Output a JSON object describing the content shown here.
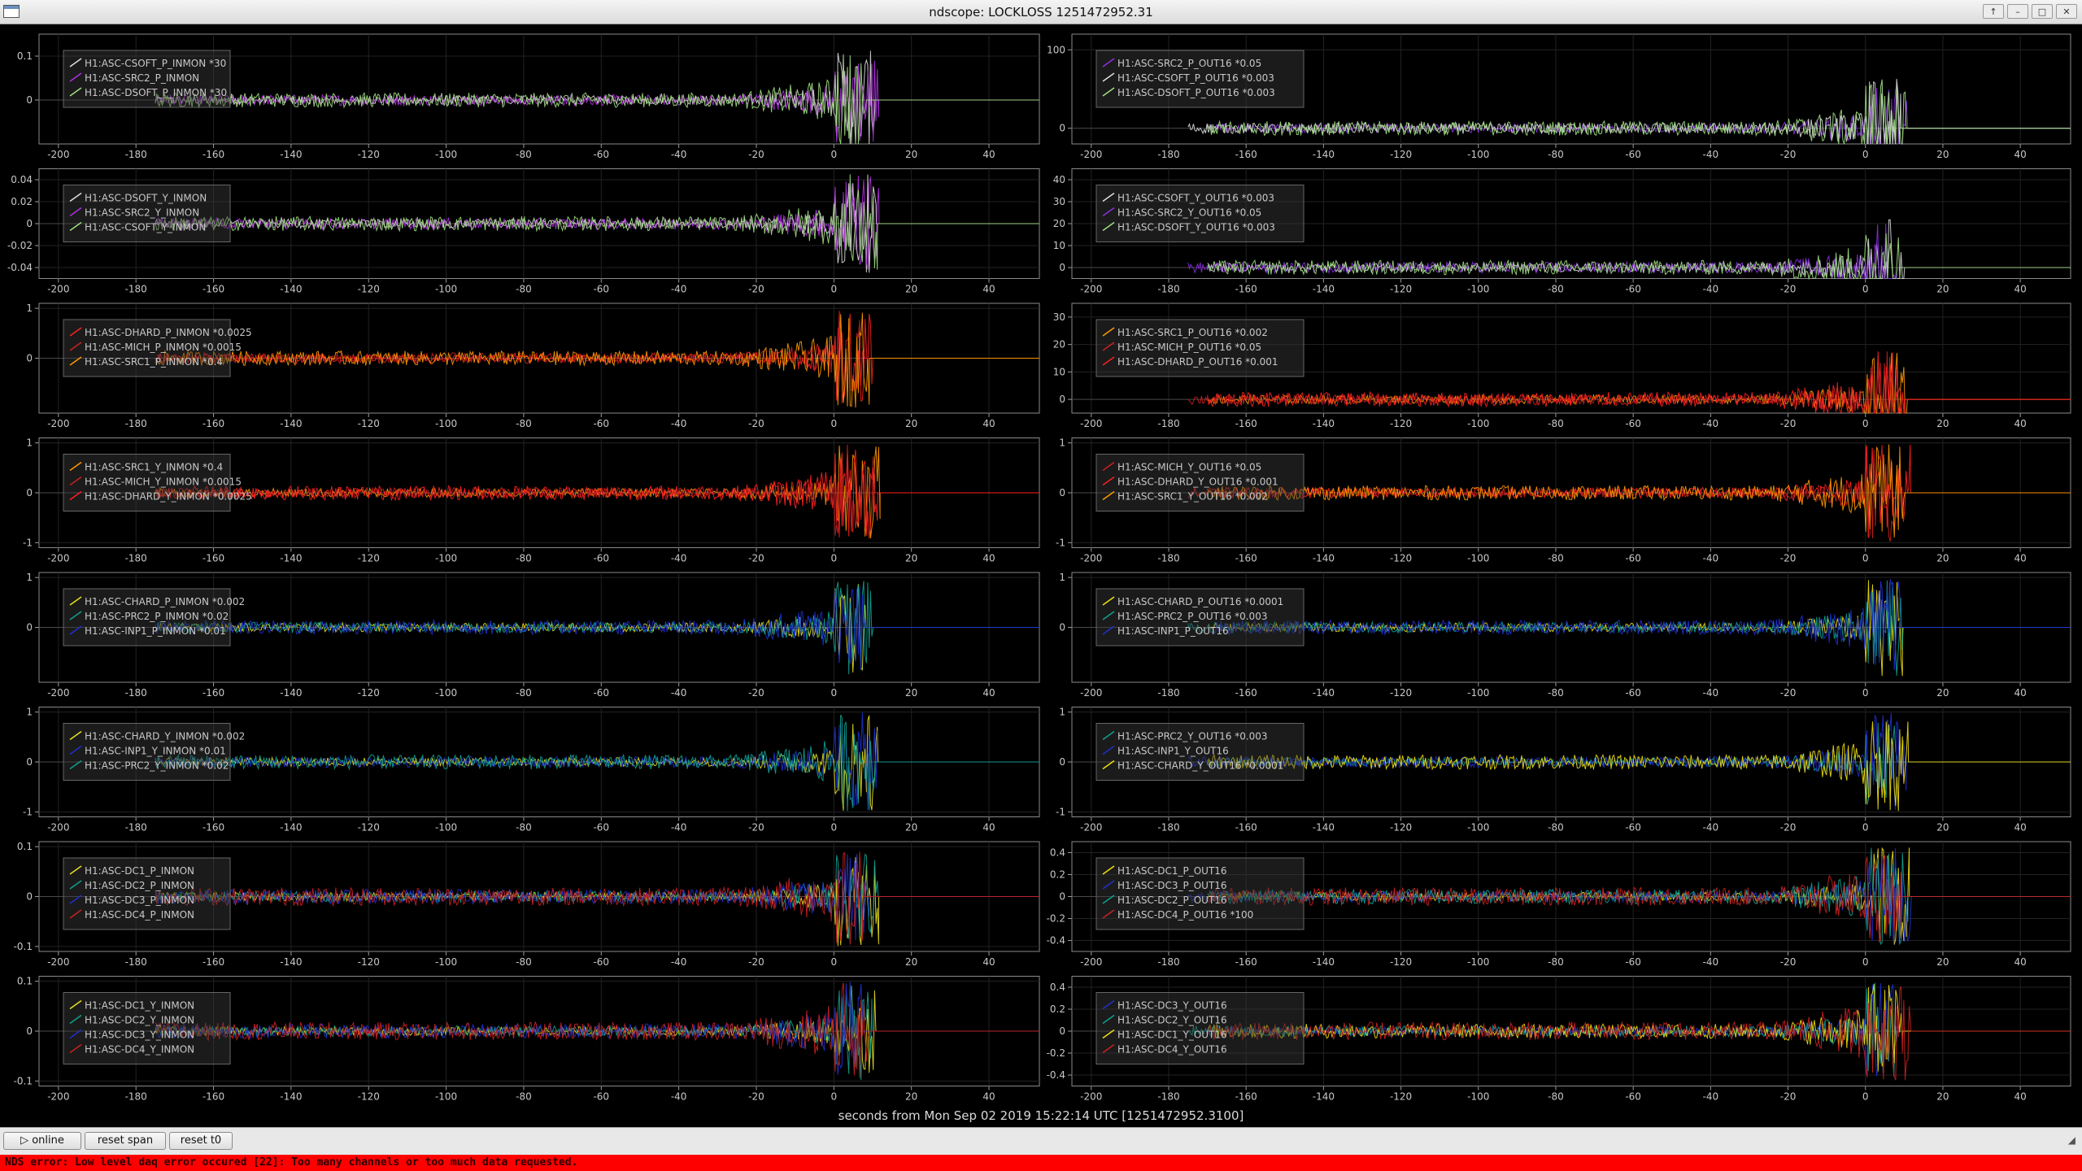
{
  "window": {
    "title": "ndscope: LOCKLOSS 1251472952.31",
    "buttons": [
      "↑",
      "–",
      "□",
      "✕"
    ]
  },
  "x_caption": "seconds from Mon Sep 02 2019 15:22:14 UTC [1251472952.3100]",
  "controls": {
    "online_label": "▷ online",
    "reset_span_label": "reset span",
    "reset_t0_label": "reset t0"
  },
  "error_message": "NDS error: Low level daq error occured [22]: Too many channels or too much data requested.",
  "colors": {
    "background": "#000000",
    "axis_text": "#c8c8c8",
    "error_bar": "#ff0000"
  },
  "chart_data": [
    {
      "type": "line",
      "xlim": [
        -205,
        53
      ],
      "x_ticks": [
        "-200",
        "-180",
        "-160",
        "-140",
        "-120",
        "-100",
        "-80",
        "-60",
        "-40",
        "-20",
        "0",
        "20",
        "40"
      ],
      "y_ticks": [
        "0.1",
        "0"
      ],
      "y_range": [
        -0.1,
        0.15
      ],
      "series": [
        {
          "name": "H1:ASC-CSOFT_P_INMON *30",
          "color": "#dddddd"
        },
        {
          "name": "H1:ASC-SRC2_P_INMON",
          "color": "#b030e0"
        },
        {
          "name": "H1:ASC-DSOFT_P_INMON *30",
          "color": "#a0e080"
        }
      ]
    },
    {
      "type": "line",
      "xlim": [
        -205,
        53
      ],
      "x_ticks": [
        "-200",
        "-180",
        "-160",
        "-140",
        "-120",
        "-100",
        "-80",
        "-60",
        "-40",
        "-20",
        "0",
        "20",
        "40"
      ],
      "y_ticks": [
        "100",
        "0"
      ],
      "y_range": [
        -20,
        120
      ],
      "series": [
        {
          "name": "H1:ASC-SRC2_P_OUT16 *0.05",
          "color": "#8a30e0"
        },
        {
          "name": "H1:ASC-CSOFT_P_OUT16 *0.003",
          "color": "#dddddd"
        },
        {
          "name": "H1:ASC-DSOFT_P_OUT16 *0.003",
          "color": "#a0e080"
        }
      ]
    },
    {
      "type": "line",
      "xlim": [
        -205,
        53
      ],
      "x_ticks": [
        "-200",
        "-180",
        "-160",
        "-140",
        "-120",
        "-100",
        "-80",
        "-60",
        "-40",
        "-20",
        "0",
        "20",
        "40"
      ],
      "y_ticks": [
        "0.04",
        "0.02",
        "0",
        "-0.02",
        "-0.04"
      ],
      "y_range": [
        -0.05,
        0.05
      ],
      "series": [
        {
          "name": "H1:ASC-DSOFT_Y_INMON",
          "color": "#dddddd"
        },
        {
          "name": "H1:ASC-SRC2_Y_INMON",
          "color": "#b030e0"
        },
        {
          "name": "H1:ASC-CSOFT_Y_INMON",
          "color": "#a0e080"
        }
      ]
    },
    {
      "type": "line",
      "xlim": [
        -205,
        53
      ],
      "x_ticks": [
        "-200",
        "-180",
        "-160",
        "-140",
        "-120",
        "-100",
        "-80",
        "-60",
        "-40",
        "-20",
        "0",
        "20",
        "40"
      ],
      "y_ticks": [
        "40",
        "30",
        "20",
        "10",
        "0"
      ],
      "y_range": [
        -5,
        45
      ],
      "series": [
        {
          "name": "H1:ASC-CSOFT_Y_OUT16 *0.003",
          "color": "#dddddd"
        },
        {
          "name": "H1:ASC-SRC2_Y_OUT16 *0.05",
          "color": "#8a30e0"
        },
        {
          "name": "H1:ASC-DSOFT_Y_OUT16 *0.003",
          "color": "#a0e080"
        }
      ]
    },
    {
      "type": "line",
      "xlim": [
        -205,
        53
      ],
      "x_ticks": [
        "-200",
        "-180",
        "-160",
        "-140",
        "-120",
        "-100",
        "-80",
        "-60",
        "-40",
        "-20",
        "0",
        "20",
        "40"
      ],
      "y_ticks": [
        "1",
        "0"
      ],
      "y_range": [
        -1.1,
        1.1
      ],
      "series": [
        {
          "name": "H1:ASC-DHARD_P_INMON *0.0025",
          "color": "#ff2020"
        },
        {
          "name": "H1:ASC-MICH_P_INMON *0.0015",
          "color": "#cc2020"
        },
        {
          "name": "H1:ASC-SRC1_P_INMON *0.4",
          "color": "#ff9900"
        }
      ]
    },
    {
      "type": "line",
      "xlim": [
        -205,
        53
      ],
      "x_ticks": [
        "-200",
        "-180",
        "-160",
        "-140",
        "-120",
        "-100",
        "-80",
        "-60",
        "-40",
        "-20",
        "0",
        "20",
        "40"
      ],
      "y_ticks": [
        "30",
        "20",
        "10",
        "0"
      ],
      "y_range": [
        -5,
        35
      ],
      "series": [
        {
          "name": "H1:ASC-SRC1_P_OUT16 *0.002",
          "color": "#ff9900"
        },
        {
          "name": "H1:ASC-MICH_P_OUT16 *0.05",
          "color": "#cc2020"
        },
        {
          "name": "H1:ASC-DHARD_P_OUT16 *0.001",
          "color": "#ff2020"
        }
      ]
    },
    {
      "type": "line",
      "xlim": [
        -205,
        53
      ],
      "x_ticks": [
        "-200",
        "-180",
        "-160",
        "-140",
        "-120",
        "-100",
        "-80",
        "-60",
        "-40",
        "-20",
        "0",
        "20",
        "40"
      ],
      "y_ticks": [
        "1",
        "0",
        "-1"
      ],
      "y_range": [
        -1.1,
        1.1
      ],
      "series": [
        {
          "name": "H1:ASC-SRC1_Y_INMON *0.4",
          "color": "#ff9900"
        },
        {
          "name": "H1:ASC-MICH_Y_INMON *0.0015",
          "color": "#cc2020"
        },
        {
          "name": "H1:ASC-DHARD_Y_INMON *0.0025",
          "color": "#ff2020"
        }
      ]
    },
    {
      "type": "line",
      "xlim": [
        -205,
        53
      ],
      "x_ticks": [
        "-200",
        "-180",
        "-160",
        "-140",
        "-120",
        "-100",
        "-80",
        "-60",
        "-40",
        "-20",
        "0",
        "20",
        "40"
      ],
      "y_ticks": [
        "1",
        "0",
        "-1"
      ],
      "y_range": [
        -1.1,
        1.1
      ],
      "series": [
        {
          "name": "H1:ASC-MICH_Y_OUT16 *0.05",
          "color": "#cc2020"
        },
        {
          "name": "H1:ASC-DHARD_Y_OUT16 *0.001",
          "color": "#ff2020"
        },
        {
          "name": "H1:ASC-SRC1_Y_OUT16 *0.002",
          "color": "#ff9900"
        }
      ]
    },
    {
      "type": "line",
      "xlim": [
        -205,
        53
      ],
      "x_ticks": [
        "-200",
        "-180",
        "-160",
        "-140",
        "-120",
        "-100",
        "-80",
        "-60",
        "-40",
        "-20",
        "0",
        "20",
        "40"
      ],
      "y_ticks": [
        "1",
        "0"
      ],
      "y_range": [
        -1.1,
        1.1
      ],
      "series": [
        {
          "name": "H1:ASC-CHARD_P_INMON *0.002",
          "color": "#e8e020"
        },
        {
          "name": "H1:ASC-PRC2_P_INMON *0.02",
          "color": "#10a090"
        },
        {
          "name": "H1:ASC-INP1_P_INMON *0.01",
          "color": "#2030d0"
        }
      ]
    },
    {
      "type": "line",
      "xlim": [
        -205,
        53
      ],
      "x_ticks": [
        "-200",
        "-180",
        "-160",
        "-140",
        "-120",
        "-100",
        "-80",
        "-60",
        "-40",
        "-20",
        "0",
        "20",
        "40"
      ],
      "y_ticks": [
        "1",
        "0"
      ],
      "y_range": [
        -1.1,
        1.1
      ],
      "series": [
        {
          "name": "H1:ASC-CHARD_P_OUT16 *0.0001",
          "color": "#f0e010"
        },
        {
          "name": "H1:ASC-PRC2_P_OUT16 *0.003",
          "color": "#10a090"
        },
        {
          "name": "H1:ASC-INP1_P_OUT16",
          "color": "#2030d0"
        }
      ]
    },
    {
      "type": "line",
      "xlim": [
        -205,
        53
      ],
      "x_ticks": [
        "-200",
        "-180",
        "-160",
        "-140",
        "-120",
        "-100",
        "-80",
        "-60",
        "-40",
        "-20",
        "0",
        "20",
        "40"
      ],
      "y_ticks": [
        "1",
        "0",
        "-1"
      ],
      "y_range": [
        -1.1,
        1.1
      ],
      "series": [
        {
          "name": "H1:ASC-CHARD_Y_INMON *0.002",
          "color": "#e8e020"
        },
        {
          "name": "H1:ASC-INP1_Y_INMON *0.01",
          "color": "#2030d0"
        },
        {
          "name": "H1:ASC-PRC2_Y_INMON *0.02",
          "color": "#10a090"
        }
      ]
    },
    {
      "type": "line",
      "xlim": [
        -205,
        53
      ],
      "x_ticks": [
        "-200",
        "-180",
        "-160",
        "-140",
        "-120",
        "-100",
        "-80",
        "-60",
        "-40",
        "-20",
        "0",
        "20",
        "40"
      ],
      "y_ticks": [
        "1",
        "0",
        "-1"
      ],
      "y_range": [
        -1.1,
        1.1
      ],
      "series": [
        {
          "name": "H1:ASC-PRC2_Y_OUT16 *0.003",
          "color": "#10a090"
        },
        {
          "name": "H1:ASC-INP1_Y_OUT16",
          "color": "#2030d0"
        },
        {
          "name": "H1:ASC-CHARD_Y_OUT16 *0.0001",
          "color": "#f0e010"
        }
      ]
    },
    {
      "type": "line",
      "xlim": [
        -205,
        53
      ],
      "x_ticks": [
        "-200",
        "-180",
        "-160",
        "-140",
        "-120",
        "-100",
        "-80",
        "-60",
        "-40",
        "-20",
        "0",
        "20",
        "40"
      ],
      "y_ticks": [
        "0.1",
        "0",
        "-0.1"
      ],
      "y_range": [
        -0.11,
        0.11
      ],
      "series": [
        {
          "name": "H1:ASC-DC1_P_INMON",
          "color": "#e8e020"
        },
        {
          "name": "H1:ASC-DC2_P_INMON",
          "color": "#10a090"
        },
        {
          "name": "H1:ASC-DC3_P_INMON",
          "color": "#2030d0"
        },
        {
          "name": "H1:ASC-DC4_P_INMON",
          "color": "#cc2020"
        }
      ]
    },
    {
      "type": "line",
      "xlim": [
        -205,
        53
      ],
      "x_ticks": [
        "-200",
        "-180",
        "-160",
        "-140",
        "-120",
        "-100",
        "-80",
        "-60",
        "-40",
        "-20",
        "0",
        "20",
        "40"
      ],
      "y_ticks": [
        "0.4",
        "0.2",
        "0",
        "-0.2",
        "-0.4"
      ],
      "y_range": [
        -0.5,
        0.5
      ],
      "series": [
        {
          "name": "H1:ASC-DC1_P_OUT16",
          "color": "#f0e010"
        },
        {
          "name": "H1:ASC-DC3_P_OUT16",
          "color": "#2030d0"
        },
        {
          "name": "H1:ASC-DC2_P_OUT16",
          "color": "#10a090"
        },
        {
          "name": "H1:ASC-DC4_P_OUT16 *100",
          "color": "#cc2020"
        }
      ]
    },
    {
      "type": "line",
      "xlim": [
        -205,
        53
      ],
      "x_ticks": [
        "-200",
        "-180",
        "-160",
        "-140",
        "-120",
        "-100",
        "-80",
        "-60",
        "-40",
        "-20",
        "0",
        "20",
        "40"
      ],
      "y_ticks": [
        "0.1",
        "0",
        "-0.1"
      ],
      "y_range": [
        -0.11,
        0.11
      ],
      "series": [
        {
          "name": "H1:ASC-DC1_Y_INMON",
          "color": "#e8e020"
        },
        {
          "name": "H1:ASC-DC2_Y_INMON",
          "color": "#10a090"
        },
        {
          "name": "H1:ASC-DC3_Y_INMON",
          "color": "#2030d0"
        },
        {
          "name": "H1:ASC-DC4_Y_INMON",
          "color": "#cc2020"
        }
      ]
    },
    {
      "type": "line",
      "xlim": [
        -205,
        53
      ],
      "x_ticks": [
        "-200",
        "-180",
        "-160",
        "-140",
        "-120",
        "-100",
        "-80",
        "-60",
        "-40",
        "-20",
        "0",
        "20",
        "40"
      ],
      "y_ticks": [
        "0.4",
        "0.2",
        "0",
        "-0.2",
        "-0.4"
      ],
      "y_range": [
        -0.5,
        0.5
      ],
      "series": [
        {
          "name": "H1:ASC-DC3_Y_OUT16",
          "color": "#2030d0"
        },
        {
          "name": "H1:ASC-DC2_Y_OUT16",
          "color": "#10a090"
        },
        {
          "name": "H1:ASC-DC1_Y_OUT16",
          "color": "#f0e010"
        },
        {
          "name": "H1:ASC-DC4_Y_OUT16",
          "color": "#cc2020"
        }
      ]
    }
  ]
}
